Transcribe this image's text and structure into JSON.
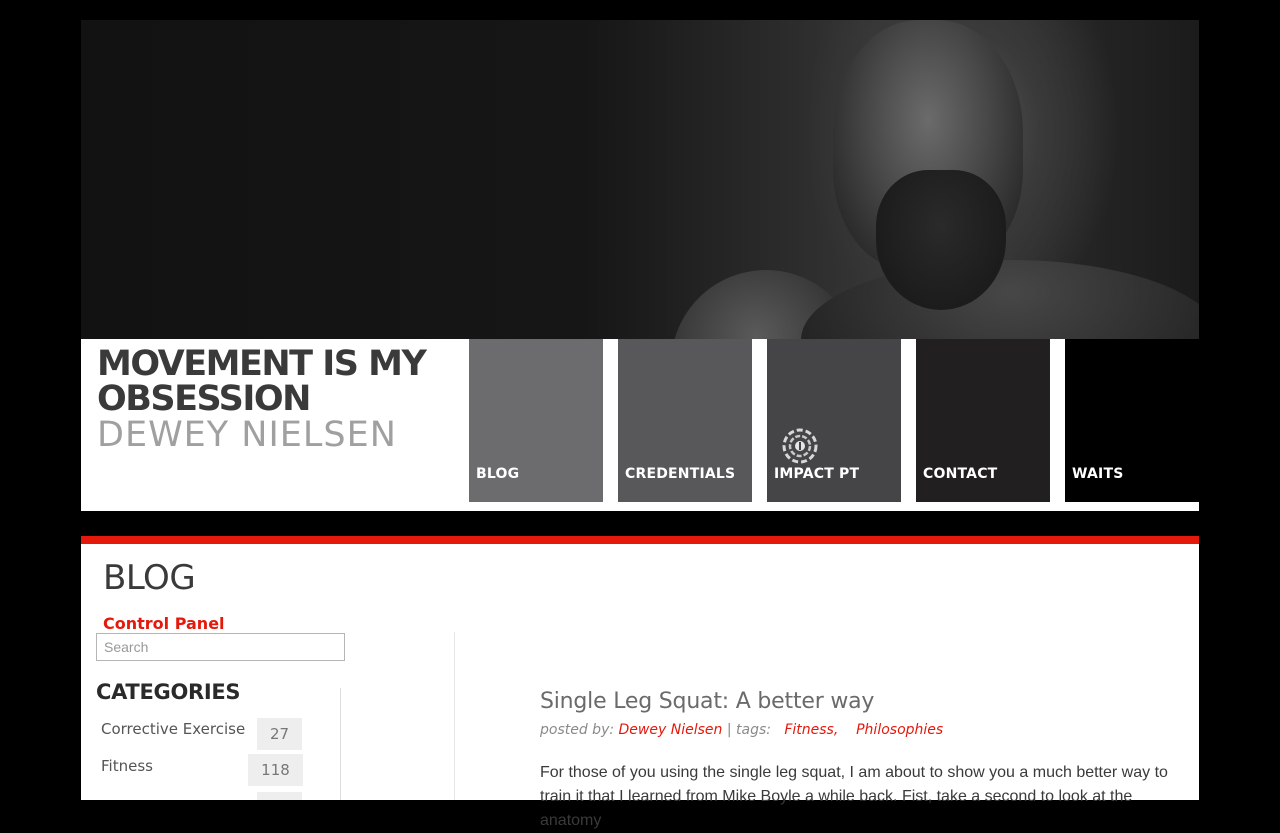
{
  "site": {
    "title": "MOVEMENT IS MY OBSESSION",
    "subtitle": "DEWEY NIELSEN"
  },
  "nav": [
    {
      "label": "BLOG",
      "color": "#6c6c6f"
    },
    {
      "label": "CREDENTIALS",
      "color": "#58585b"
    },
    {
      "label": "IMPACT PT",
      "color": "#454548",
      "icon": "impact-pt-logo"
    },
    {
      "label": "CONTACT",
      "color": "#221f20"
    },
    {
      "label": "WAITS",
      "color": "#000000"
    }
  ],
  "page": {
    "title": "BLOG",
    "control_panel": "Control Panel"
  },
  "search": {
    "placeholder": "Search"
  },
  "categories": {
    "heading": "CATEGORIES",
    "items": [
      {
        "name": "Corrective Exercise",
        "count": "27"
      },
      {
        "name": "Fitness",
        "count": "118"
      }
    ]
  },
  "post": {
    "title": "Single Leg Squat: A better way",
    "posted_by_label": "posted by:",
    "author": "Dewey Nielsen",
    "tags_label": "| tags:",
    "tags": [
      "Fitness,",
      "Philosophies"
    ],
    "excerpt": "For those of you using the single leg squat, I am about to show you a much better way to train it that I learned from Mike Boyle a while back. Fist, take a second to look at the anatomy"
  },
  "colors": {
    "accent": "#e4190c"
  }
}
